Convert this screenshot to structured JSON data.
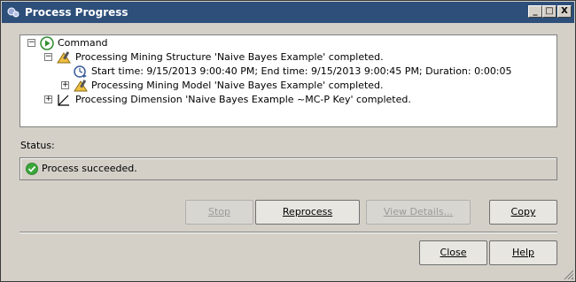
{
  "window": {
    "title": "Process Progress",
    "minimize_glyph": "_",
    "maximize_glyph": "□",
    "close_glyph": "X"
  },
  "tree": {
    "rows": [
      {
        "expander": "−",
        "icon": "play-icon",
        "text": "Command"
      },
      {
        "expander": "−",
        "icon": "mining-structure-icon",
        "text": "Processing Mining Structure 'Naive Bayes Example' completed."
      },
      {
        "expander": null,
        "icon": "clock-icon",
        "text": "Start time: 9/15/2013 9:00:40 PM; End time: 9/15/2013 9:00:45 PM; Duration: 0:00:05"
      },
      {
        "expander": "+",
        "icon": "mining-model-icon",
        "text": "Processing Mining Model 'Naive Bayes Example' completed."
      },
      {
        "expander": "+",
        "icon": "dimension-icon",
        "text": "Processing Dimension 'Naive Bayes Example ~MC-P Key' completed."
      }
    ]
  },
  "status": {
    "label": "Status:",
    "icon": "check-circle-icon",
    "text": "Process succeeded.",
    "color": "#3aa63a"
  },
  "buttons": {
    "stop": "Stop",
    "reprocess": "Reprocess",
    "view_details": "View Details...",
    "copy": "Copy",
    "close": "Close",
    "help": "Help"
  }
}
